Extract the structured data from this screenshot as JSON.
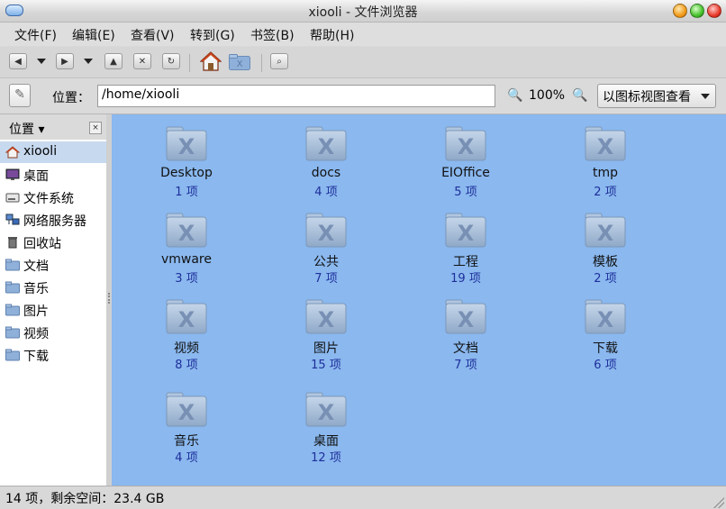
{
  "window": {
    "title": "xiooli - 文件浏览器"
  },
  "menubar": {
    "items": [
      {
        "label": "文件(F)"
      },
      {
        "label": "编辑(E)"
      },
      {
        "label": "查看(V)"
      },
      {
        "label": "转到(G)"
      },
      {
        "label": "书签(B)"
      },
      {
        "label": "帮助(H)"
      }
    ]
  },
  "location": {
    "label": "位置：",
    "path": "/home/xiooli",
    "zoom": "100%",
    "view_mode": "以图标视图查看"
  },
  "sidebar": {
    "header": "位置",
    "items": [
      {
        "label": "xiooli",
        "icon": "home-icon",
        "selected": true
      },
      {
        "label": "桌面",
        "icon": "desktop-icon"
      },
      {
        "label": "文件系统",
        "icon": "drive-icon"
      },
      {
        "label": "网络服务器",
        "icon": "network-icon"
      },
      {
        "label": "回收站",
        "icon": "trash-icon"
      },
      {
        "label": "文档",
        "icon": "folder-icon"
      },
      {
        "label": "音乐",
        "icon": "folder-icon"
      },
      {
        "label": "图片",
        "icon": "folder-icon"
      },
      {
        "label": "视频",
        "icon": "folder-icon"
      },
      {
        "label": "下载",
        "icon": "folder-icon"
      }
    ]
  },
  "files": [
    {
      "name": "Desktop",
      "count": "1 项"
    },
    {
      "name": "docs",
      "count": "4 项"
    },
    {
      "name": "EIOffice",
      "count": "5 项"
    },
    {
      "name": "tmp",
      "count": "2 项"
    },
    {
      "name": "vmware",
      "count": "3 项"
    },
    {
      "name": "公共",
      "count": "7 项"
    },
    {
      "name": "工程",
      "count": "19 项"
    },
    {
      "name": "模板",
      "count": "2 项"
    },
    {
      "name": "视频",
      "count": "8 项"
    },
    {
      "name": "图片",
      "count": "15 项"
    },
    {
      "name": "文档",
      "count": "7 项"
    },
    {
      "name": "下载",
      "count": "6 项"
    },
    {
      "name": "音乐",
      "count": "4 项"
    },
    {
      "name": "桌面",
      "count": "12 项"
    }
  ],
  "status": {
    "text": "14 项，剩余空间：23.4 GB"
  },
  "colors": {
    "view_background": "#8ab8ef",
    "count_text": "#1f2f9a",
    "selection": "#c7d9ef"
  }
}
